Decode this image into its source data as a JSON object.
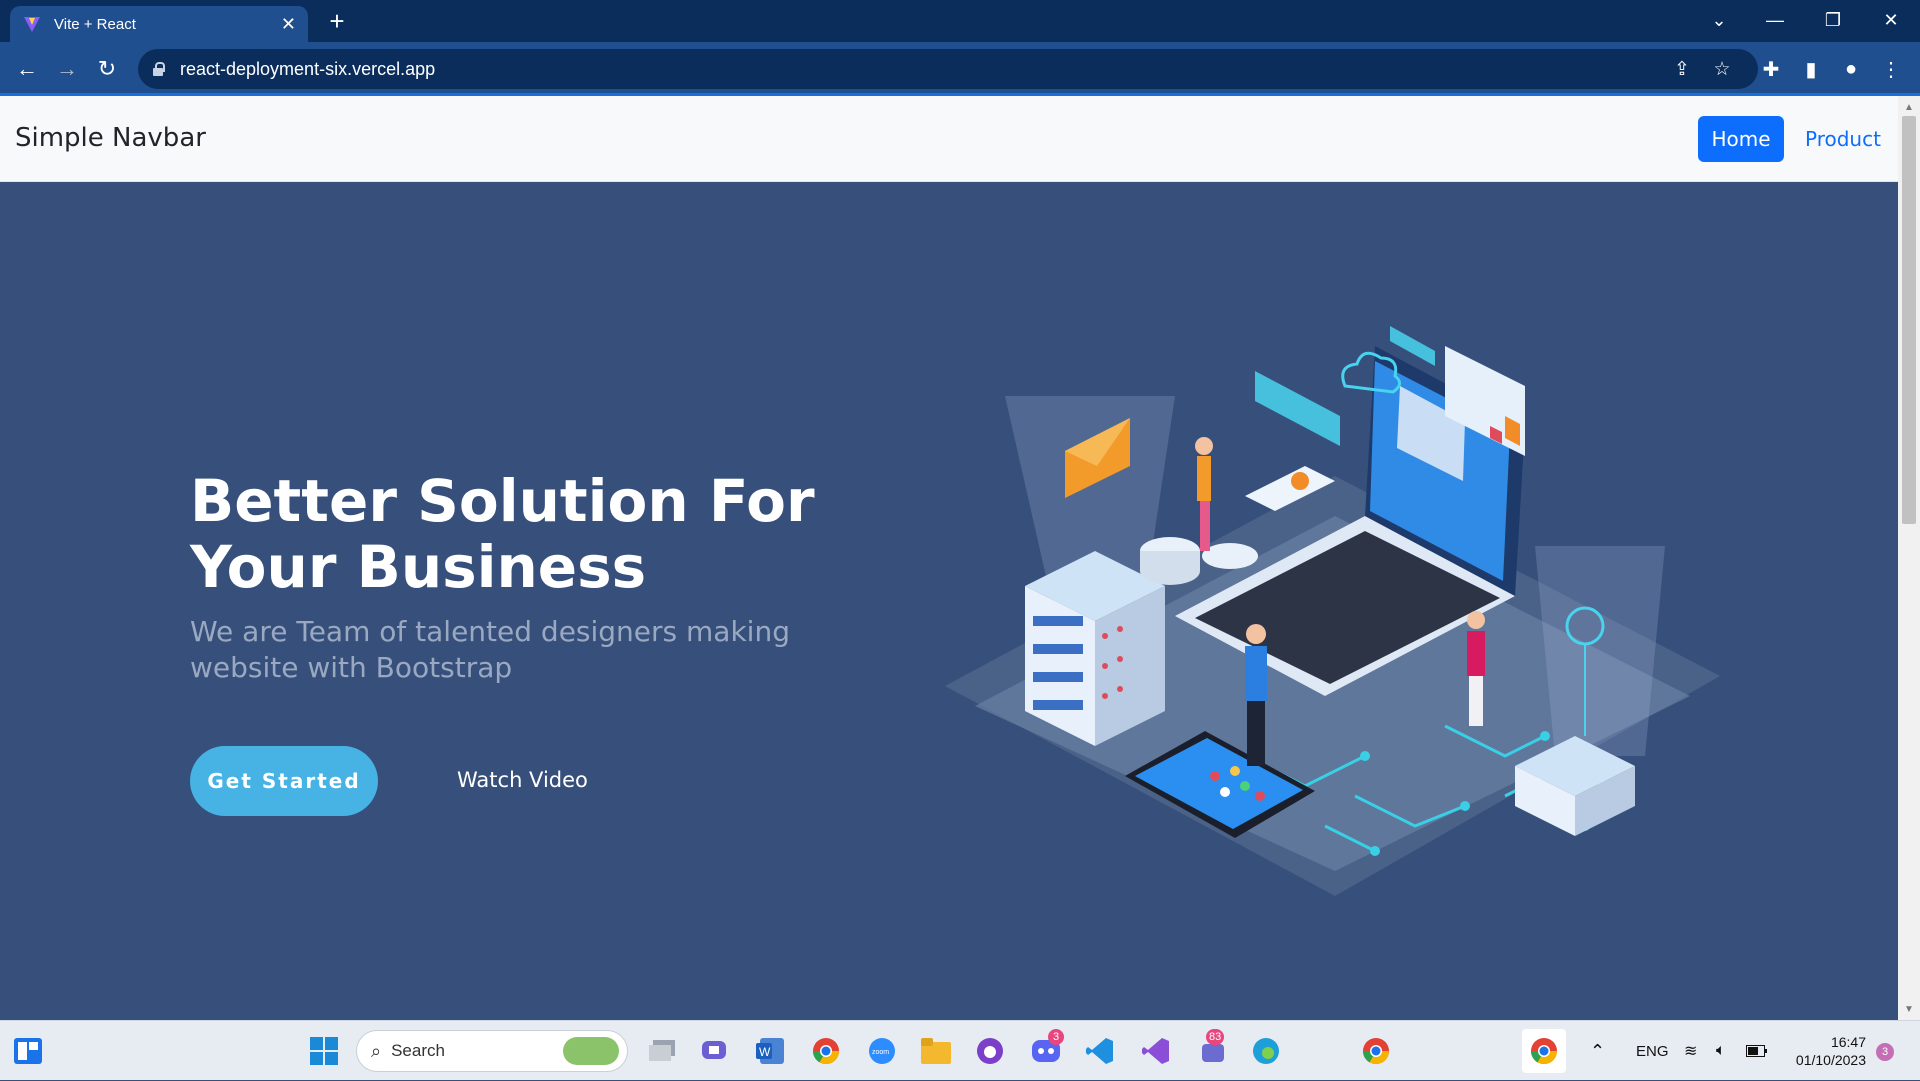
{
  "browser": {
    "tab_title": "Vite + React",
    "url": "react-deployment-six.vercel.app"
  },
  "navbar": {
    "brand": "Simple Navbar",
    "links": [
      "Home",
      "Product"
    ],
    "active": "Home"
  },
  "hero": {
    "title": "Better Solution For Your Business",
    "subtitle": "We are Team of talented designers making website with Bootstrap",
    "cta_primary": "Get Started",
    "cta_secondary": "Watch Video"
  },
  "taskbar": {
    "search_placeholder": "Search",
    "language": "ENG",
    "time": "16:47",
    "date": "01/10/2023",
    "notifications_count": "3",
    "badges": {
      "teams": "83",
      "discord": "3"
    }
  },
  "colors": {
    "hero_bg": "#37507b",
    "primary": "#0d6efd",
    "accent": "#47b2e4",
    "tab_bg": "#0b2d5c"
  }
}
